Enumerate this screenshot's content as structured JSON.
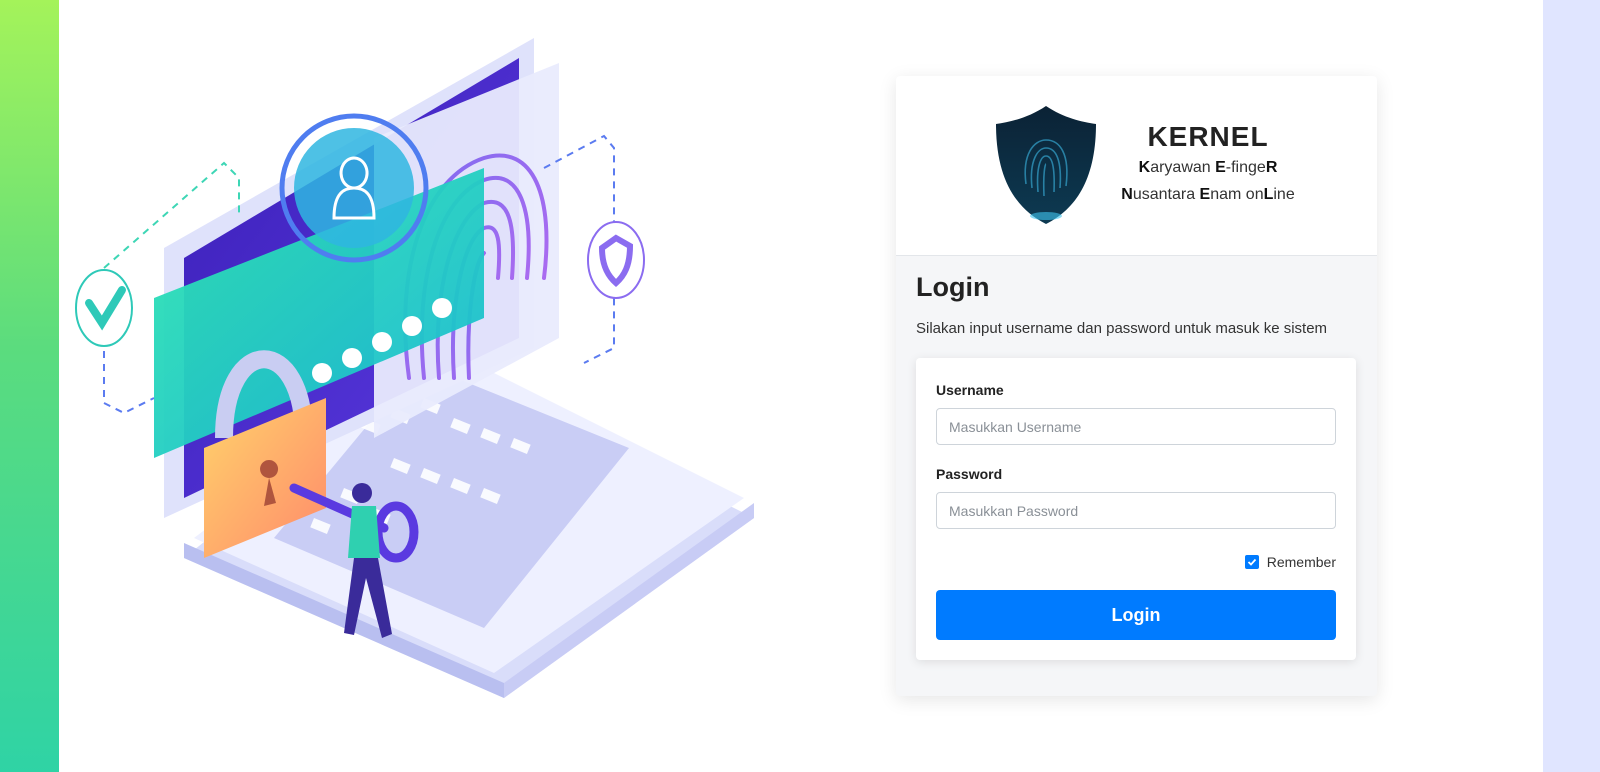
{
  "brand": {
    "title": "KERNEL",
    "line1": [
      {
        "b": "K",
        "t": "aryawan "
      },
      {
        "b": "E",
        "t": "-finge"
      },
      {
        "b": "R",
        "t": ""
      }
    ],
    "line2": [
      {
        "b": "N",
        "t": "usantara "
      },
      {
        "b": "E",
        "t": "nam on"
      },
      {
        "b": "L",
        "t": "ine"
      }
    ]
  },
  "login": {
    "title": "Login",
    "subtitle": "Silakan input username dan password untuk masuk ke sistem",
    "username_label": "Username",
    "username_placeholder": "Masukkan Username",
    "password_label": "Password",
    "password_placeholder": "Masukkan Password",
    "remember_label": "Remember",
    "remember_checked": true,
    "button_label": "Login"
  },
  "colors": {
    "primary": "#007bff",
    "stripe_left_top": "#a4f35a",
    "stripe_left_bottom": "#2fd3a5",
    "stripe_right": "#e0e5ff"
  },
  "icons": {
    "illustration": "security-login-illustration",
    "logo": "fingerprint-shield-icon"
  }
}
